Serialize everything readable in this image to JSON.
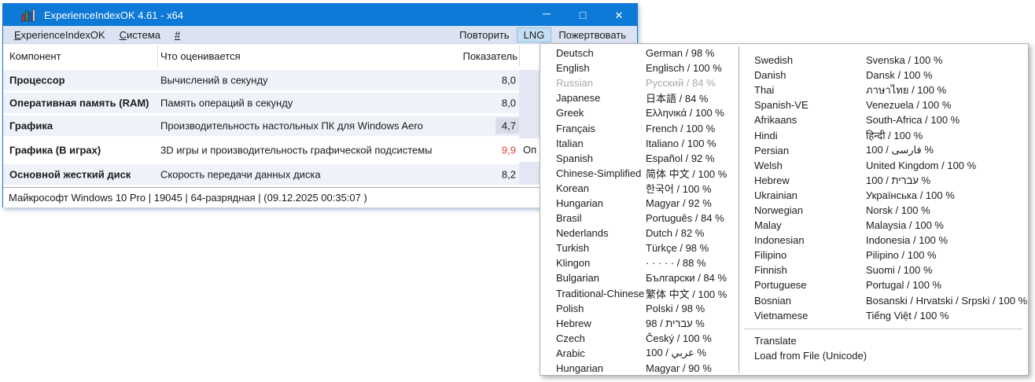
{
  "window": {
    "title": "ExperienceIndexOK 4.61 - x64",
    "controls": {
      "minimize_glyph": "─",
      "maximize_glyph": "□",
      "close_glyph": "✕"
    },
    "menubar": {
      "left_items": [
        {
          "label": "ExperienceIndexOK",
          "accel_first_letter": true
        },
        {
          "label": "Система",
          "accel_first_letter": true
        },
        {
          "label": "#",
          "accel_first_letter": true
        }
      ],
      "right_items": [
        {
          "label": "Повторить",
          "highlighted": false
        },
        {
          "label": "LNG",
          "highlighted": true
        },
        {
          "label": "Пожертвовать",
          "highlighted": false
        }
      ]
    },
    "table": {
      "headers": [
        "Компонент",
        "Что оценивается",
        "Показатель"
      ],
      "rows": [
        {
          "component": "Процессор",
          "description": "Вычислений в секунду",
          "score": "8,0",
          "score_style": "normal"
        },
        {
          "component": "Оперативная память (RAM)",
          "description": "Память операций в секунду",
          "score": "8,0",
          "score_style": "normal"
        },
        {
          "component": "Графика",
          "description": "Производительность настольных ПК для Windows Aero",
          "score": "4,7",
          "score_style": "highlighted"
        },
        {
          "component": "Графика (В играх)",
          "description": "3D игры и производительность графической подсистемы",
          "score": "9,9",
          "score_style": "red",
          "side_label": "Оп"
        },
        {
          "component": "Основной жесткий диск",
          "description": "Скорость передачи данных диска",
          "score": "8,2",
          "score_style": "normal"
        }
      ]
    },
    "statusbar": {
      "text": "Майкрософт Windows 10 Pro | 19045 | 64-разрядная | (09.12.2025 00:35:07 )"
    }
  },
  "lang_menu": {
    "left_column": [
      {
        "name": "Deutsch",
        "translation": "German / 98 %"
      },
      {
        "name": "English",
        "translation": "Englisch / 100 %"
      },
      {
        "name": "Russian",
        "translation": "Русский / 84 %",
        "disabled": true
      },
      {
        "name": "Japanese",
        "translation": "日本語 / 84 %"
      },
      {
        "name": "Greek",
        "translation": "Ελληνικά / 100 %"
      },
      {
        "name": "Français",
        "translation": "French / 100 %"
      },
      {
        "name": "Italian",
        "translation": "Italiano / 100 %"
      },
      {
        "name": "Spanish",
        "translation": "Español / 92 %"
      },
      {
        "name": "Chinese-Simplified",
        "translation": "简体 中文 / 100 %"
      },
      {
        "name": "Korean",
        "translation": "한국어 / 100 %"
      },
      {
        "name": "Hungarian",
        "translation": "Magyar / 92 %"
      },
      {
        "name": "Brasil",
        "translation": "Português / 84 %"
      },
      {
        "name": "Nederlands",
        "translation": "Dutch / 82 %"
      },
      {
        "name": "Turkish",
        "translation": "Türkçe / 98 %"
      },
      {
        "name": "Klingon",
        "translation": "· · · · · / 88 %"
      },
      {
        "name": "Bulgarian",
        "translation": "Български / 84 %"
      },
      {
        "name": "Traditional-Chinese",
        "translation": "繁体 中文 / 100 %"
      },
      {
        "name": "Polish",
        "translation": "Polski / 98 %"
      },
      {
        "name": "Hebrew",
        "translation": "98 / עברית %"
      },
      {
        "name": "Czech",
        "translation": "Český / 100 %"
      },
      {
        "name": "Arabic",
        "translation": "100 / عربي %"
      },
      {
        "name": "Hungarian",
        "translation": "Magyar / 90 %"
      }
    ],
    "right_column": [
      {
        "name": "Swedish",
        "translation": "Svenska / 100 %"
      },
      {
        "name": "Danish",
        "translation": "Dansk / 100 %"
      },
      {
        "name": "Thai",
        "translation": "ภาษาไทย / 100 %"
      },
      {
        "name": "Spanish-VE",
        "translation": "Venezuela / 100 %"
      },
      {
        "name": "Afrikaans",
        "translation": "South-Africa / 100 %"
      },
      {
        "name": "Hindi",
        "translation": "हिन्दी / 100 %"
      },
      {
        "name": "Persian",
        "translation": "100 / فارسی %"
      },
      {
        "name": "Welsh",
        "translation": "United Kingdom / 100 %"
      },
      {
        "name": "Hebrew",
        "translation": "100 / עברית %"
      },
      {
        "name": "Ukrainian",
        "translation": "Українська / 100 %"
      },
      {
        "name": "Norwegian",
        "translation": "Norsk / 100 %"
      },
      {
        "name": "Malay",
        "translation": "Malaysia / 100 %"
      },
      {
        "name": "Indonesian",
        "translation": "Indonesia / 100 %"
      },
      {
        "name": "Filipino",
        "translation": "Pilipino / 100 %"
      },
      {
        "name": "Finnish",
        "translation": "Suomi / 100 %"
      },
      {
        "name": "Portuguese",
        "translation": "Portugal / 100 %"
      },
      {
        "name": "Bosnian",
        "translation": "Bosanski / Hrvatski / Srpski / 100 %"
      },
      {
        "name": "Vietnamese",
        "translation": "Tiếng Việt / 100 %"
      }
    ],
    "footer_items": [
      "Translate",
      "Load from File (Unicode)"
    ]
  },
  "colors": {
    "titlebar_blue": "#0e7ad8",
    "menubar_bg": "#dbe3f2",
    "lng_highlight_bg": "#c6def4",
    "row_tint": "#f0f2f9",
    "score_cell_highlight": "#d9ddeb",
    "score_red": "#e83b3b"
  }
}
